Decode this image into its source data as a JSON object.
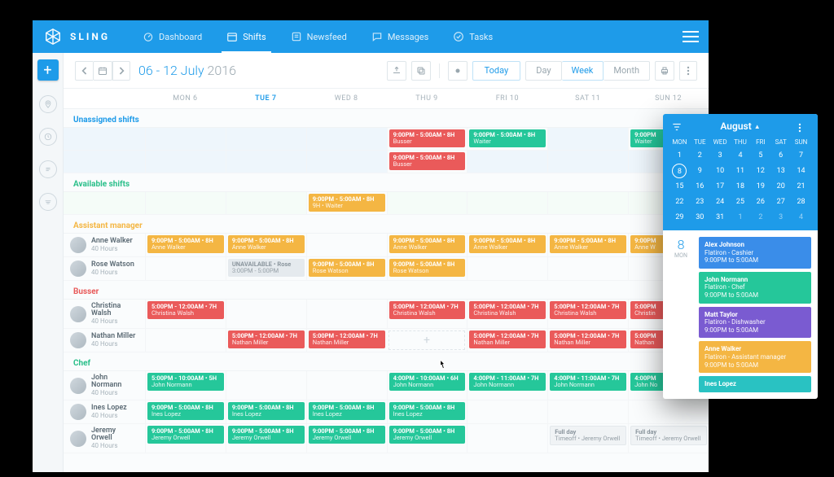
{
  "brand": {
    "name": "SLING"
  },
  "nav": {
    "items": [
      {
        "label": "Dashboard"
      },
      {
        "label": "Shifts",
        "active": true
      },
      {
        "label": "Newsfeed"
      },
      {
        "label": "Messages"
      },
      {
        "label": "Tasks"
      }
    ]
  },
  "toolbar": {
    "range_primary": "06 - 12 July",
    "range_year": "2016",
    "today": "Today",
    "seg": {
      "day": "Day",
      "week": "Week",
      "month": "Month",
      "active": "week"
    }
  },
  "days": [
    {
      "label": "MON 6"
    },
    {
      "label": "TUE 7",
      "selected": true
    },
    {
      "label": "WED 8"
    },
    {
      "label": "THU 9"
    },
    {
      "label": "FRI 10"
    },
    {
      "label": "SAT 11"
    },
    {
      "label": "SUN 12"
    }
  ],
  "sections": {
    "unassigned": {
      "title": "Unassigned shifts",
      "rows": [
        {
          "shifts": [
            null,
            null,
            null,
            {
              "color": "red",
              "l1": "9:00PM - 5:00AM • 8H",
              "l2": "Busser"
            },
            {
              "color": "green",
              "l1": "9:00PM - 5:00AM • 8H",
              "l2": "Waiter"
            },
            null,
            {
              "color": "green_trim",
              "l1": "9:00PM",
              "l2": "Waiter"
            }
          ]
        },
        {
          "shifts": [
            null,
            null,
            null,
            {
              "color": "red",
              "l1": "9:00PM - 5:00AM • 8H",
              "l2": "Busser"
            },
            null,
            null,
            null
          ]
        }
      ]
    },
    "available": {
      "title": "Available shifts",
      "rows": [
        {
          "shifts": [
            null,
            null,
            {
              "color": "orange",
              "l1": "9:00PM - 5:00AM • 8H",
              "l2": "9H • Waiter"
            },
            null,
            null,
            null,
            null
          ]
        }
      ]
    },
    "asstmgr": {
      "title": "Assistant manager",
      "employees": [
        {
          "name": "Anne Walker",
          "hours": "40 Hours",
          "shifts": [
            {
              "color": "orange",
              "l1": "9:00PM - 5:00AM • 8H",
              "l2": "Anne Walker"
            },
            {
              "color": "orange",
              "l1": "9:00PM - 5:00AM • 8H",
              "l2": "Anne Walker"
            },
            null,
            {
              "color": "orange",
              "l1": "9:00PM - 5:00AM • 8H",
              "l2": "Anne Walker"
            },
            {
              "color": "orange",
              "l1": "9:00PM - 5:00AM • 8H",
              "l2": "Anne Walker"
            },
            {
              "color": "orange",
              "l1": "9:00PM - 5:00AM • 8H",
              "l2": "Anne Walker"
            },
            {
              "color": "orange_trim",
              "l1": "9:00PM",
              "l2": "Anne W"
            }
          ]
        },
        {
          "name": "Rose Watson",
          "hours": "40 Hours",
          "shifts": [
            null,
            {
              "color": "grey",
              "l1": "UNAVAILABLE • Rose",
              "l2": "3:00PM - 5:00PM"
            },
            {
              "color": "orange",
              "l1": "9:00PM - 5:00AM • 8H",
              "l2": "Rose Watson"
            },
            {
              "color": "orange",
              "l1": "9:00PM - 5:00AM • 8H",
              "l2": "Rose Watson"
            },
            null,
            null,
            null
          ]
        }
      ]
    },
    "busser": {
      "title": "Busser",
      "employees": [
        {
          "name": "Christina Walsh",
          "hours": "40 Hours",
          "shifts": [
            {
              "color": "red",
              "l1": "5:00PM - 12:00AM • 7H",
              "l2": "Christina Walsh"
            },
            null,
            null,
            {
              "color": "red",
              "l1": "5:00PM - 12:00AM • 7H",
              "l2": "Christina Walsh"
            },
            {
              "color": "red",
              "l1": "5:00PM - 12:00AM • 7H",
              "l2": "Christina Walsh"
            },
            {
              "color": "red",
              "l1": "5:00PM - 12:00AM • 7H",
              "l2": "Christina Walsh"
            },
            {
              "color": "red_trim",
              "l1": "5:00PM",
              "l2": "Christin"
            }
          ]
        },
        {
          "name": "Nathan Miller",
          "hours": "40 Hours",
          "shifts": [
            null,
            {
              "color": "red",
              "l1": "5:00PM - 12:00AM • 7H",
              "l2": "Nathan Miller"
            },
            {
              "color": "red",
              "l1": "5:00PM - 12:00AM • 7H",
              "l2": "Nathan Miller"
            },
            {
              "color": "add"
            },
            {
              "color": "red",
              "l1": "5:00PM - 12:00AM • 7H",
              "l2": "Nathan Miller"
            },
            {
              "color": "red",
              "l1": "5:00PM - 12:00AM • 7H",
              "l2": "Nathan Miller"
            },
            {
              "color": "red_trim",
              "l1": "5:00PM",
              "l2": "Nathan"
            }
          ]
        }
      ]
    },
    "chef": {
      "title": "Chef",
      "employees": [
        {
          "name": "John Normann",
          "hours": "40 Hours",
          "shifts": [
            {
              "color": "green",
              "l1": "5:00PM - 10:00AM • 5H",
              "l2": "John Normann"
            },
            null,
            null,
            {
              "color": "green",
              "l1": "4:00PM - 10:00AM • 6H",
              "l2": "John Normann"
            },
            {
              "color": "green",
              "l1": "4:00PM - 11:00AM • 7H",
              "l2": "John Normann"
            },
            {
              "color": "green",
              "l1": "4:00PM - 11:00AM • 7H",
              "l2": "John Normann"
            },
            {
              "color": "green_trim",
              "l1": "4:00PM",
              "l2": "John No"
            }
          ]
        },
        {
          "name": "Ines Lopez",
          "hours": "40 Hours",
          "shifts": [
            {
              "color": "green",
              "l1": "9:00PM - 5:00AM • 8H",
              "l2": "Ines Lopez"
            },
            {
              "color": "green",
              "l1": "9:00PM - 5:00AM • 8H",
              "l2": "Ines Lopez"
            },
            {
              "color": "green",
              "l1": "9:00PM - 5:00AM • 8H",
              "l2": "Ines Lopez"
            },
            {
              "color": "green",
              "l1": "9:00PM - 5:00AM • 8H",
              "l2": "Ines Lopez"
            },
            null,
            null,
            null
          ]
        },
        {
          "name": "Jeremy Orwell",
          "hours": "40 Hours",
          "shifts": [
            {
              "color": "green",
              "l1": "9:00PM - 5:00AM • 8H",
              "l2": "Jeremy Orwell"
            },
            {
              "color": "green",
              "l1": "9:00PM - 5:00AM • 8H",
              "l2": "Jeremy Orwell"
            },
            {
              "color": "green",
              "l1": "9:00PM - 5:00AM • 8H",
              "l2": "Jeremy Orwell"
            },
            {
              "color": "green",
              "l1": "9:00PM - 5:00AM • 8H",
              "l2": "Jeremy Orwell"
            },
            null,
            {
              "color": "greyb",
              "l1": "Full day",
              "l2": "Timeoff • Jeremy Orwell"
            },
            {
              "color": "greyb",
              "l1": "Full day",
              "l2": "Timeoff • Jeremy Orwell"
            }
          ]
        }
      ]
    }
  },
  "popover": {
    "month": "August",
    "dow": [
      "MON",
      "TUE",
      "WED",
      "THU",
      "FRI",
      "SAT",
      "SUN"
    ],
    "weeks": [
      [
        1,
        2,
        3,
        4,
        5,
        6,
        7
      ],
      [
        8,
        9,
        10,
        11,
        12,
        13,
        14
      ],
      [
        15,
        16,
        17,
        18,
        19,
        20,
        21
      ],
      [
        22,
        23,
        24,
        25,
        26,
        27,
        28
      ],
      [
        29,
        30,
        31,
        1,
        2,
        3,
        4
      ]
    ],
    "selected": 8,
    "trailing_from": 32,
    "day_badge": {
      "num": "8",
      "lbl": "MON"
    },
    "entries": [
      {
        "color": "blue",
        "c1": "Alex Johnson",
        "c2": "Flatiron - Cashier",
        "c3": "9:00PM to 5:00AM"
      },
      {
        "color": "green",
        "c1": "John Normann",
        "c2": "Flatiron - Chef",
        "c3": "9:00PM to 5:00AM"
      },
      {
        "color": "purple",
        "c1": "Matt Taylor",
        "c2": "Flatiron - Dishwasher",
        "c3": "9:00PM to 5:00AM"
      },
      {
        "color": "orange",
        "c1": "Anne Walker",
        "c2": "Flatiron - Assistant manager",
        "c3": "9:00PM to 5:00AM"
      },
      {
        "color": "teal",
        "c1": "Ines Lopez",
        "c2": "",
        "c3": ""
      }
    ]
  }
}
